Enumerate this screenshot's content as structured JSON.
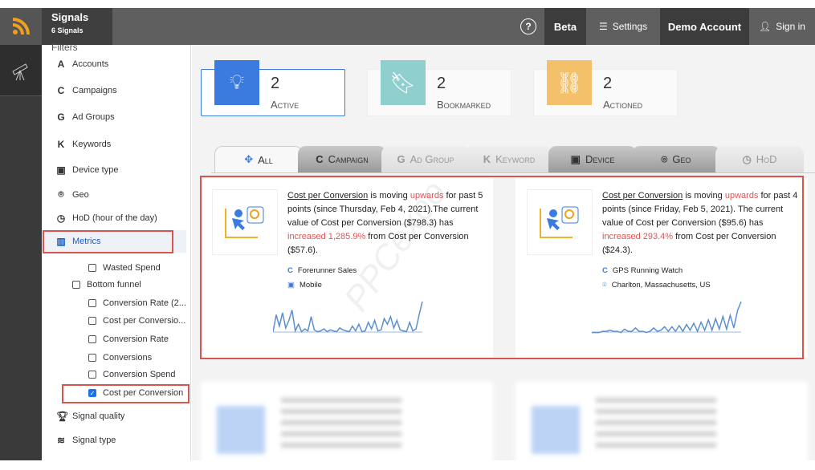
{
  "topbar": {
    "app_title": "Signals",
    "app_subtitle": "6 Signals",
    "help": "?",
    "beta": "Beta",
    "settings": "Settings",
    "account": "Demo Account",
    "signin": "Sign in"
  },
  "sidebar": {
    "heading": "Filters",
    "items": [
      {
        "icon": "A",
        "label": "Accounts"
      },
      {
        "icon": "C",
        "label": "Campaigns"
      },
      {
        "icon": "G",
        "label": "Ad Groups"
      },
      {
        "icon": "K",
        "label": "Keywords"
      },
      {
        "icon": "device",
        "label": "Device type"
      },
      {
        "icon": "pin",
        "label": "Geo"
      },
      {
        "icon": "clock",
        "label": "HoD (hour of the day)"
      },
      {
        "icon": "chart",
        "label": "Metrics"
      }
    ],
    "metrics": [
      {
        "label": "Wasted Spend",
        "checked": false
      },
      {
        "label": "Bottom funnel",
        "checked": false
      },
      {
        "label": "Conversion Rate (2...",
        "checked": false
      },
      {
        "label": "Cost per Conversio...",
        "checked": false
      },
      {
        "label": "Conversion Rate",
        "checked": false
      },
      {
        "label": "Conversions",
        "checked": false
      },
      {
        "label": "Conversion Spend",
        "checked": false
      },
      {
        "label": "Cost per Conversion",
        "checked": true
      }
    ],
    "bottom": [
      {
        "label": "Signal quality"
      },
      {
        "label": "Signal type"
      }
    ]
  },
  "summary": [
    {
      "count": "2",
      "label": "Active",
      "color": "#3b7be0"
    },
    {
      "count": "2",
      "label": "Bookmarked",
      "color": "#8fd0cf"
    },
    {
      "count": "2",
      "label": "Actioned",
      "color": "#f4c06a"
    }
  ],
  "tabs": [
    "All",
    "Campaign",
    "Ad Group",
    "Keyword",
    "Device",
    "Geo",
    "HoD"
  ],
  "cards": [
    {
      "metric": "Cost per Conversion",
      "t1": " is moving ",
      "dir": "upwards",
      "t2": " for past 5 points (since Thursday, Feb 4, 2021).The current value of Cost per Conversion ($798.3) has ",
      "chg": "increased 1,285.9%",
      "t3": " from Cost per Conversion ($57.6).",
      "campaign": "Forerunner Sales",
      "dim": "Mobile",
      "dim_icon": "device",
      "spark": [
        2,
        20,
        8,
        22,
        6,
        14,
        25,
        3,
        10,
        2,
        5,
        3,
        18,
        4,
        2,
        3,
        5,
        2,
        4,
        3,
        2,
        6,
        4,
        3,
        2,
        8,
        3,
        10,
        2,
        3,
        12,
        5,
        14,
        3,
        4,
        16,
        10,
        18,
        6,
        14,
        4,
        3,
        2,
        12,
        3,
        5,
        20,
        34
      ]
    },
    {
      "metric": "Cost per Conversion",
      "t1": " is moving ",
      "dir": "upwards",
      "t2": " for past 4 points (since Friday, Feb 5, 2021). The current value of Cost per Conversion ($95.6) has ",
      "chg": "increased 293.4%",
      "t3": " from Cost per Conversion ($24.3).",
      "campaign": "GPS Running Watch",
      "dim": "Charlton, Massachusetts, US",
      "dim_icon": "pin",
      "spark": [
        1,
        1,
        1,
        2,
        2,
        3,
        2,
        2,
        1,
        4,
        2,
        2,
        5,
        2,
        2,
        1,
        2,
        5,
        2,
        3,
        6,
        2,
        6,
        2,
        7,
        2,
        8,
        3,
        9,
        2,
        10,
        3,
        12,
        3,
        13,
        4,
        15,
        4,
        16,
        5,
        20,
        28
      ]
    }
  ],
  "watermark": "PPCexpo"
}
